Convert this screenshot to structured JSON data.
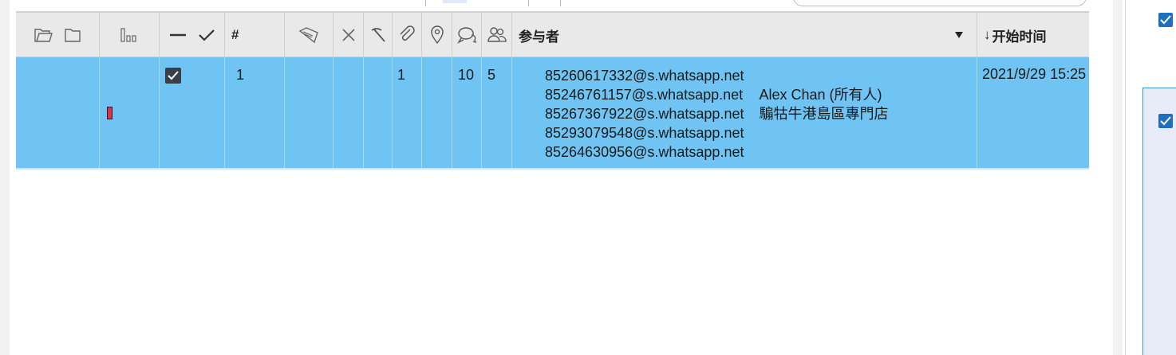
{
  "header": {
    "participants_label": "参与者",
    "start_time_label": "开始时间",
    "hash_label": "#",
    "sort_arrow": "↓"
  },
  "row": {
    "number": "1",
    "attachments": "1",
    "messages": "10",
    "participant_count": "5",
    "participants": [
      {
        "address": "85260617332@s.whatsapp.net",
        "name": ""
      },
      {
        "address": "85246761157@s.whatsapp.net",
        "name": "Alex Chan (所有人)"
      },
      {
        "address": "85267367922@s.whatsapp.net",
        "name": "騸牯牛港島區專門店"
      },
      {
        "address": "85293079548@s.whatsapp.net",
        "name": ""
      },
      {
        "address": "85264630956@s.whatsapp.net",
        "name": ""
      }
    ],
    "start_time": "2021/9/29 15:25",
    "checked": true
  },
  "colors": {
    "row_highlight": "#6fc4f3",
    "header_bg": "#e9e9e9",
    "accent": "#1f6fbf",
    "marker": "#d9334d"
  }
}
